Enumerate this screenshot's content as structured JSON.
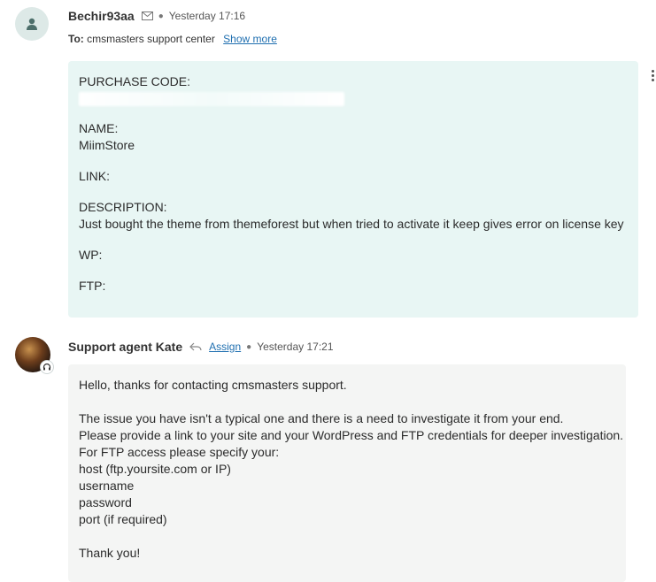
{
  "message1": {
    "sender": "Bechir93aa",
    "time": "Yesterday 17:16",
    "to_label": "To:",
    "recipient": "cmsmasters support center",
    "show_more": "Show more",
    "fields": [
      {
        "label": "PURCHASE CODE:",
        "value": ""
      },
      {
        "label": "NAME:",
        "value": "MiimStore"
      },
      {
        "label": "LINK:",
        "value": ""
      },
      {
        "label": "DESCRIPTION:",
        "value": "Just bought the theme from themeforest but when tried to activate it keep gives error on license key"
      },
      {
        "label": "WP:",
        "value": ""
      },
      {
        "label": "FTP:",
        "value": ""
      }
    ]
  },
  "message2": {
    "sender": "Support agent Kate",
    "assign": "Assign",
    "time": "Yesterday 17:21",
    "lines": [
      "Hello, thanks for contacting cmsmasters support.",
      "",
      "The issue you have isn't a typical one and there is a need to investigate it from your end.",
      "Please provide a link to your site and your WordPress and FTP credentials for deeper investigation.",
      "For FTP access please specify your:",
      "host (ftp.yoursite.com or IP)",
      "username",
      "password",
      "port (if required)",
      "",
      "Thank you!"
    ]
  },
  "icons": {
    "avatar1": "user-icon",
    "envelope": "envelope-icon",
    "reply": "reply-icon",
    "headset": "headset-icon",
    "more": "kebab-menu-icon"
  },
  "colors": {
    "customer_bubble": "#e8f6f4",
    "agent_bubble": "#f4f5f4",
    "link": "#1f6fb0"
  }
}
